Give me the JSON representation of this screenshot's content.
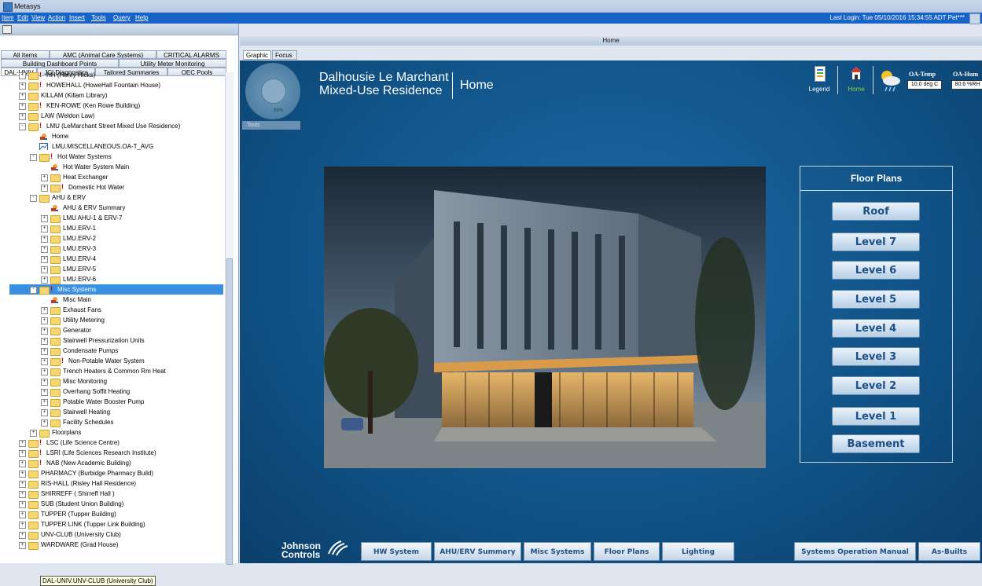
{
  "window": {
    "title": "Metasys"
  },
  "menu": {
    "items": [
      "Item",
      "Edit",
      "View",
      "Action",
      "Insert",
      "Tools",
      "Query",
      "Help"
    ],
    "login": "Last Login: Tue 05/10/2016 15:34:55 ADT Pet***"
  },
  "left": {
    "tabs_row1": [
      "All Items",
      "AMC (Animal Care Systems)",
      "CRITICAL ALARMS"
    ],
    "tabs_row2": [
      "Building Dashboard Points",
      "Utility Meter Monitoring"
    ],
    "tabs_row3": [
      "DAL-UNIV",
      "JCI Diagnostics",
      "Tailored Summaries",
      "OEC Pools"
    ],
    "tree": [
      {
        "label": "HH (Henry Hicks)",
        "indent": 0,
        "type": "folder",
        "exp": "+",
        "alarm": true
      },
      {
        "label": "HOWEHALL (HoweHall Fountain House)",
        "indent": 0,
        "type": "folder",
        "exp": "+",
        "alarm": true
      },
      {
        "label": "KILLAM (Killam Library)",
        "indent": 0,
        "type": "folder",
        "exp": "+",
        "alarm": false
      },
      {
        "label": "KEN-ROWE (Ken Rowe Building)",
        "indent": 0,
        "type": "folder",
        "exp": "+",
        "alarm": true
      },
      {
        "label": "LAW (Weldon Law)",
        "indent": 0,
        "type": "folder",
        "exp": "+",
        "alarm": false
      },
      {
        "label": "LMU (LeMarchant Street Mixed Use Residence)",
        "indent": 0,
        "type": "folder",
        "exp": "-",
        "alarm": true
      },
      {
        "label": "Home",
        "indent": 1,
        "type": "graphic",
        "exp": "",
        "alarm": false
      },
      {
        "label": "LMU.MISCELLANEOUS.OA-T_AVG",
        "indent": 1,
        "type": "trend",
        "exp": "",
        "alarm": false
      },
      {
        "label": "Hot Water Systems",
        "indent": 1,
        "type": "folder",
        "exp": "-",
        "alarm": true
      },
      {
        "label": "Hot Water System Main",
        "indent": 2,
        "type": "graphic",
        "exp": "",
        "alarm": false
      },
      {
        "label": "Heat Exchanger",
        "indent": 2,
        "type": "folder",
        "exp": "+",
        "alarm": false
      },
      {
        "label": "Domestic Hot Water",
        "indent": 2,
        "type": "folder",
        "exp": "+",
        "alarm": true
      },
      {
        "label": "AHU & ERV",
        "indent": 1,
        "type": "folder",
        "exp": "-",
        "alarm": false
      },
      {
        "label": "AHU & ERV Summary",
        "indent": 2,
        "type": "graphic",
        "exp": "",
        "alarm": false
      },
      {
        "label": "LMU AHU-1 & ERV-7",
        "indent": 2,
        "type": "folder",
        "exp": "+",
        "alarm": false
      },
      {
        "label": "LMU.ERV-1",
        "indent": 2,
        "type": "folder",
        "exp": "+",
        "alarm": false
      },
      {
        "label": "LMU.ERV-2",
        "indent": 2,
        "type": "folder",
        "exp": "+",
        "alarm": false
      },
      {
        "label": "LMU.ERV-3",
        "indent": 2,
        "type": "folder",
        "exp": "+",
        "alarm": false
      },
      {
        "label": "LMU.ERV-4",
        "indent": 2,
        "type": "folder",
        "exp": "+",
        "alarm": false
      },
      {
        "label": "LMU.ERV-5",
        "indent": 2,
        "type": "folder",
        "exp": "+",
        "alarm": false
      },
      {
        "label": "LMU.ERV-6",
        "indent": 2,
        "type": "folder",
        "exp": "+",
        "alarm": false
      },
      {
        "label": "Misc Systems",
        "indent": 1,
        "type": "folder",
        "exp": "-",
        "alarm": true,
        "selected": true
      },
      {
        "label": "Misc Main",
        "indent": 2,
        "type": "graphic",
        "exp": "",
        "alarm": false
      },
      {
        "label": "Exhaust Fans",
        "indent": 2,
        "type": "folder",
        "exp": "+",
        "alarm": false
      },
      {
        "label": "Utility Metering",
        "indent": 2,
        "type": "folder",
        "exp": "+",
        "alarm": false
      },
      {
        "label": "Generator",
        "indent": 2,
        "type": "folder",
        "exp": "+",
        "alarm": false
      },
      {
        "label": "Stairwell Pressurization Units",
        "indent": 2,
        "type": "folder",
        "exp": "+",
        "alarm": false
      },
      {
        "label": "Condensate Pumps",
        "indent": 2,
        "type": "folder",
        "exp": "+",
        "alarm": false
      },
      {
        "label": "Non-Potable Water System",
        "indent": 2,
        "type": "folder",
        "exp": "+",
        "alarm": true
      },
      {
        "label": "Trench Heaters & Common Rm Heat",
        "indent": 2,
        "type": "folder",
        "exp": "+",
        "alarm": false
      },
      {
        "label": "Misc Monitoring",
        "indent": 2,
        "type": "folder",
        "exp": "+",
        "alarm": false
      },
      {
        "label": "Overhang Soffit Heating",
        "indent": 2,
        "type": "folder",
        "exp": "+",
        "alarm": false
      },
      {
        "label": "Potable Water Booster Pump",
        "indent": 2,
        "type": "folder",
        "exp": "+",
        "alarm": false
      },
      {
        "label": "Stairwell Heating",
        "indent": 2,
        "type": "folder",
        "exp": "+",
        "alarm": false
      },
      {
        "label": "Facility Schedules",
        "indent": 2,
        "type": "folder",
        "exp": "+",
        "alarm": false
      },
      {
        "label": "Floorplans",
        "indent": 1,
        "type": "folder",
        "exp": "+",
        "alarm": false
      },
      {
        "label": "LSC (Life Science Centre)",
        "indent": 0,
        "type": "folder",
        "exp": "+",
        "alarm": true
      },
      {
        "label": "LSRI (Life Sciences Research Institute)",
        "indent": 0,
        "type": "folder",
        "exp": "+",
        "alarm": true
      },
      {
        "label": "NAB (New Academic Building)",
        "indent": 0,
        "type": "folder",
        "exp": "+",
        "alarm": true
      },
      {
        "label": "PHARMACY (Burbidge Pharmacy Build)",
        "indent": 0,
        "type": "folder",
        "exp": "+",
        "alarm": false
      },
      {
        "label": "RIS-HALL (Risley Hall Residence)",
        "indent": 0,
        "type": "folder",
        "exp": "+",
        "alarm": false
      },
      {
        "label": "SHIRREFF ( Shirreff Hall )",
        "indent": 0,
        "type": "folder",
        "exp": "+",
        "alarm": false
      },
      {
        "label": "SUB (Student Union Building)",
        "indent": 0,
        "type": "folder",
        "exp": "+",
        "alarm": false
      },
      {
        "label": "TUPPER (Tupper Building)",
        "indent": 0,
        "type": "folder",
        "exp": "+",
        "alarm": false
      },
      {
        "label": "TUPPER LINK (Tupper Link Building)",
        "indent": 0,
        "type": "folder",
        "exp": "+",
        "alarm": false
      },
      {
        "label": "UNV-CLUB (University Club)",
        "indent": 0,
        "type": "folder",
        "exp": "+",
        "alarm": false
      },
      {
        "label": "WARDWARE (Grad House)",
        "indent": 0,
        "type": "folder",
        "exp": "+",
        "alarm": false
      }
    ],
    "tooltip": "DAL-UNIV.UNV-CLUB (University Club)"
  },
  "right": {
    "frame_title": "Home",
    "tabs": [
      "Graphic",
      "Focus"
    ],
    "zoom": "95%",
    "tools_label": "Tools",
    "building_line1": "Dalhousie Le Marchant",
    "building_line2": "Mixed-Use Residence",
    "page_title": "Home",
    "legend_label": "Legend",
    "home_label": "Home",
    "oa_temp_label": "OA-Temp",
    "oa_temp_value": "10.0 deg C",
    "oa_hum_label": "OA-Hum",
    "oa_hum_value": "80.6 %RH",
    "floor_plans_title": "Floor Plans",
    "floors": [
      "Roof",
      "Level 7",
      "Level 6",
      "Level 5",
      "Level 4",
      "Level 3",
      "Level 2",
      "Level 1",
      "Basement"
    ],
    "logo_line1": "Johnson",
    "logo_line2": "Controls",
    "nav_buttons": [
      "HW System",
      "AHU/ERV Summary",
      "Misc Systems",
      "Floor Plans",
      "Lighting",
      "Systems Operation Manual",
      "As-Builts"
    ]
  },
  "colors": {
    "menubar": "#1763c6",
    "graphic_bg": "#105286",
    "home_green": "#8bd33a",
    "button_text": "#1e4f86",
    "selection": "#3a8fe0"
  }
}
